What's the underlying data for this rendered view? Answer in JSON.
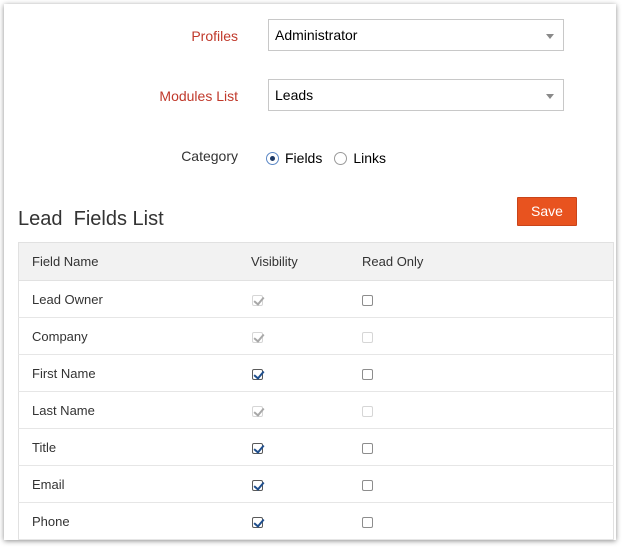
{
  "form": {
    "profiles_label": "Profiles",
    "profiles_value": "Administrator",
    "modules_label": "Modules List",
    "modules_value": "Leads",
    "category_label": "Category",
    "category_options": [
      "Fields",
      "Links"
    ],
    "category_selected": "Fields"
  },
  "list": {
    "title": "Lead  Fields List",
    "save_label": "Save",
    "headers": [
      "Field Name",
      "Visibility",
      "Read Only"
    ],
    "rows": [
      {
        "name": "Lead Owner",
        "visibility": true,
        "visibility_disabled": true,
        "read_only": false,
        "read_only_disabled": false
      },
      {
        "name": "Company",
        "visibility": true,
        "visibility_disabled": true,
        "read_only": false,
        "read_only_disabled": true
      },
      {
        "name": "First Name",
        "visibility": true,
        "visibility_disabled": false,
        "read_only": false,
        "read_only_disabled": false
      },
      {
        "name": "Last Name",
        "visibility": true,
        "visibility_disabled": true,
        "read_only": false,
        "read_only_disabled": true
      },
      {
        "name": "Title",
        "visibility": true,
        "visibility_disabled": false,
        "read_only": false,
        "read_only_disabled": false
      },
      {
        "name": "Email",
        "visibility": true,
        "visibility_disabled": false,
        "read_only": false,
        "read_only_disabled": false
      },
      {
        "name": "Phone",
        "visibility": true,
        "visibility_disabled": false,
        "read_only": false,
        "read_only_disabled": false
      }
    ]
  },
  "colors": {
    "label_red": "#c0392b",
    "save_button": "#e8531f",
    "header_bg": "#f2f2f2",
    "checkmark": "#1f4e8c"
  },
  "icons": {
    "dropdown": "chevron-down-icon",
    "radio": "radio-icon",
    "checkbox": "checkbox-icon"
  }
}
